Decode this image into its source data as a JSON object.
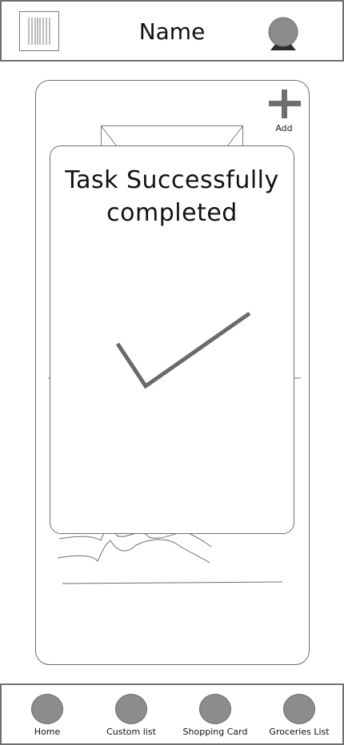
{
  "header": {
    "title": "Name",
    "menu_icon": "barcode-menu-icon",
    "avatar_icon": "user-avatar-icon"
  },
  "main": {
    "add_label": "Add",
    "add_icon": "plus-icon"
  },
  "modal": {
    "title_line1": "Task Successfully",
    "title_line2": "completed",
    "icon": "checkmark-icon"
  },
  "nav": {
    "items": [
      {
        "label": "Home",
        "icon": "circle-icon"
      },
      {
        "label": "Custom list",
        "icon": "circle-icon"
      },
      {
        "label": "Shopping Card",
        "icon": "circle-icon"
      },
      {
        "label": "Groceries List",
        "icon": "circle-icon"
      }
    ]
  },
  "colors": {
    "border": "#6f6f6f",
    "icon_fill": "#8c8c8c",
    "check_stroke": "#6a6a6a"
  }
}
